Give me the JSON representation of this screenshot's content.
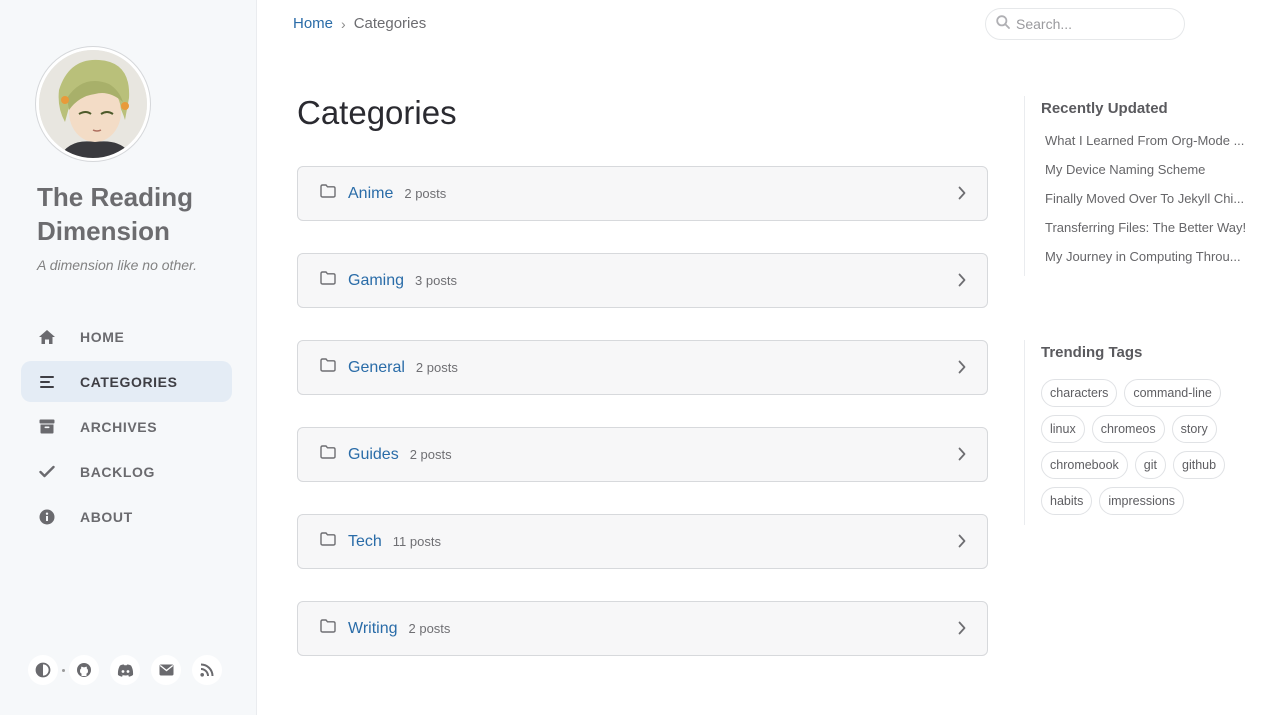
{
  "sidebar": {
    "title": "The Reading Dimension",
    "subtitle": "A dimension like no other.",
    "nav": [
      {
        "label": "HOME",
        "icon": "home-icon"
      },
      {
        "label": "CATEGORIES",
        "icon": "list-icon",
        "active": true
      },
      {
        "label": "ARCHIVES",
        "icon": "archive-icon"
      },
      {
        "label": "BACKLOG",
        "icon": "check-icon"
      },
      {
        "label": "ABOUT",
        "icon": "info-icon"
      }
    ],
    "bottom_icons": [
      "theme-toggle-icon",
      "github-icon",
      "discord-icon",
      "email-icon",
      "rss-icon"
    ]
  },
  "breadcrumb": {
    "home": "Home",
    "separator": "›",
    "current": "Categories"
  },
  "search": {
    "placeholder": "Search..."
  },
  "page": {
    "title": "Categories"
  },
  "categories": [
    {
      "name": "Anime",
      "count": "2 posts"
    },
    {
      "name": "Gaming",
      "count": "3 posts"
    },
    {
      "name": "General",
      "count": "2 posts"
    },
    {
      "name": "Guides",
      "count": "2 posts"
    },
    {
      "name": "Tech",
      "count": "11 posts"
    },
    {
      "name": "Writing",
      "count": "2 posts"
    }
  ],
  "recently_updated": {
    "heading": "Recently Updated",
    "items": [
      "What I Learned From Org-Mode ...",
      "My Device Naming Scheme",
      "Finally Moved Over To Jekyll Chi...",
      "Transferring Files: The Better Way!",
      "My Journey in Computing Throu..."
    ]
  },
  "trending_tags": {
    "heading": "Trending Tags",
    "tags": [
      "characters",
      "command-line",
      "linux",
      "chromeos",
      "story",
      "chromebook",
      "git",
      "github",
      "habits",
      "impressions"
    ]
  },
  "colors": {
    "link": "#2a6ca8",
    "sidebar_bg": "#f6f8fa",
    "active_nav_bg": "#e4ecf5",
    "card_bg": "#f7f7f8"
  }
}
